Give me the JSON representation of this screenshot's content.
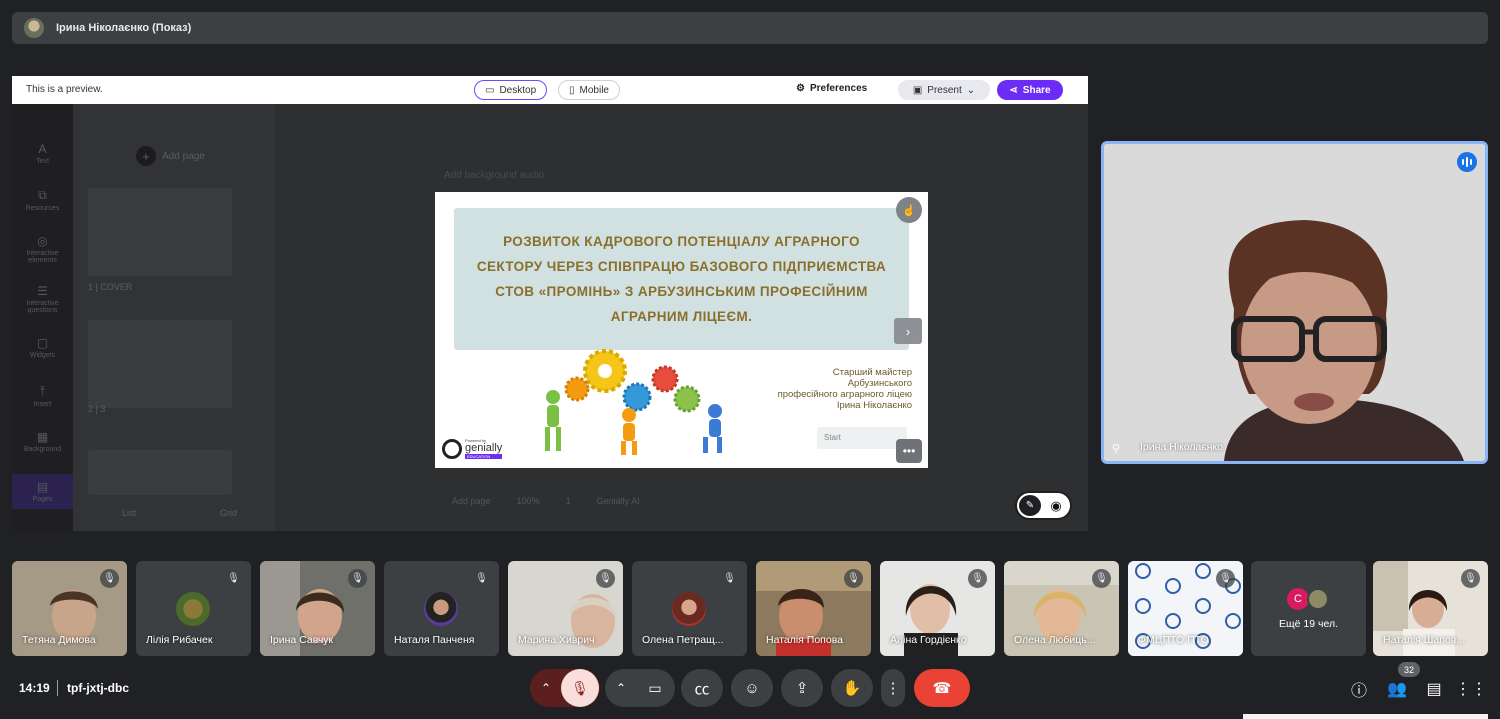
{
  "presenter_bar": {
    "title": "Ірина Ніколаєнко (Показ)"
  },
  "preview_bar": {
    "notice": "This is a preview.",
    "desktop_label": "Desktop",
    "mobile_label": "Mobile",
    "preferences_label": "Preferences",
    "present_label": "Present",
    "share_label": "Share"
  },
  "editor": {
    "sidebar": [
      "Text",
      "Resources",
      "Interactive elements",
      "Interactive questions",
      "Widgets",
      "Insert",
      "Background",
      "Pages"
    ],
    "add_page": "Add page",
    "pages": [
      "1 | COVER",
      "2 | 3"
    ],
    "list_label": "List",
    "grid_label": "Grid",
    "add_background": "Add background audio",
    "bottom_tools": [
      "Add page",
      "100%",
      "1",
      "Genially AI"
    ]
  },
  "slide": {
    "title": "РОЗВИТОК КАДРОВОГО ПОТЕНЦІАЛУ АГРАРНОГО СЕКТОРУ ЧЕРЕЗ СПІВПРАЦЮ БАЗОВОГО ПІДПРИЄМСТВА СТОВ «ПРОМІНЬ» З АРБУЗИНСЬКИМ ПРОФЕСІЙНИМ АГРАРНИМ ЛІЦЕЄМ.",
    "author_lines": [
      "Старший майстер",
      "Арбузинського",
      "професійного аграрного ліцею",
      "Ірина Ніколаєнко"
    ],
    "start_label": "Start",
    "brand_powered": "Powered by",
    "brand_name": "genially",
    "brand_edu": "EDUCATION"
  },
  "presenter_tile": {
    "name": "Ірина Ніколаєнко"
  },
  "participants": [
    {
      "name": "Тетяна Димова"
    },
    {
      "name": "Лілія Рибачек"
    },
    {
      "name": "Ірина Савчук"
    },
    {
      "name": "Наталя Панченя"
    },
    {
      "name": "Марина Хиврич"
    },
    {
      "name": "Олена Петращ..."
    },
    {
      "name": "Наталія Попова"
    },
    {
      "name": "Аліна Гордієнко"
    },
    {
      "name": "Олена Любиць..."
    },
    {
      "name": "ФМЦПТО ПТО"
    },
    {
      "name": "Наталія Шапов..."
    }
  ],
  "more_tile": {
    "label": "Ещё 19 чел.",
    "initial": "C"
  },
  "bottom_bar": {
    "time": "14:19",
    "meeting_code": "tpf-jxtj-dbc",
    "people_count": "32"
  },
  "colors": {
    "background": "#202124",
    "accent_blue": "#8ab4f8",
    "end_call_red": "#ea4335",
    "mic_off_bg": "#f9dedc",
    "genially_purple": "#6d2cf5"
  }
}
